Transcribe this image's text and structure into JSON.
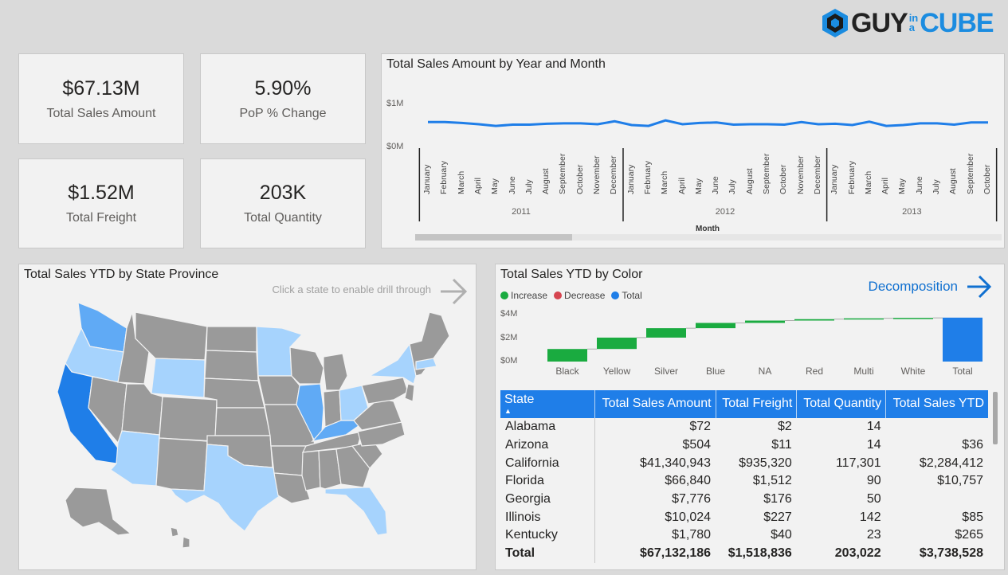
{
  "logo": {
    "guy": "GUY",
    "in": "in",
    "a": "a",
    "cube": "CUBE"
  },
  "kpis": [
    {
      "value": "$67.13M",
      "label": "Total Sales Amount"
    },
    {
      "value": "5.90%",
      "label": "PoP % Change"
    },
    {
      "value": "$1.52M",
      "label": "Total Freight"
    },
    {
      "value": "203K",
      "label": "Total Quantity"
    }
  ],
  "line_chart": {
    "title": "Total Sales Amount by Year and Month",
    "y_ticks": [
      "$1M",
      "$0M"
    ],
    "years": [
      "2011",
      "2012",
      "2013"
    ],
    "x_axis_title": "Month"
  },
  "map": {
    "title": "Total Sales YTD by State Province",
    "hint": "Click a state to enable drill through"
  },
  "waterfall": {
    "title": "Total Sales YTD by Color",
    "legend": [
      {
        "label": "Increase",
        "color": "#1aab40"
      },
      {
        "label": "Decrease",
        "color": "#d64550"
      },
      {
        "label": "Total",
        "color": "#1f7ee8"
      }
    ],
    "y_ticks": [
      "$4M",
      "$2M",
      "$0M"
    ],
    "link_label": "Decomposition"
  },
  "table": {
    "headers": [
      "State",
      "Total Sales Amount",
      "Total Freight",
      "Total Quantity",
      "Total Sales YTD"
    ],
    "rows": [
      [
        "Alabama",
        "$72",
        "$2",
        "14",
        ""
      ],
      [
        "Arizona",
        "$504",
        "$11",
        "14",
        "$36"
      ],
      [
        "California",
        "$41,340,943",
        "$935,320",
        "117,301",
        "$2,284,412"
      ],
      [
        "Florida",
        "$66,840",
        "$1,512",
        "90",
        "$10,757"
      ],
      [
        "Georgia",
        "$7,776",
        "$176",
        "50",
        ""
      ],
      [
        "Illinois",
        "$10,024",
        "$227",
        "142",
        "$85"
      ],
      [
        "Kentucky",
        "$1,780",
        "$40",
        "23",
        "$265"
      ]
    ],
    "total": [
      "Total",
      "$67,132,186",
      "$1,518,836",
      "203,022",
      "$3,738,528"
    ]
  },
  "chart_data": [
    {
      "type": "line",
      "title": "Total Sales Amount by Year and Month",
      "xlabel": "Month",
      "ylabel": "",
      "ylim": [
        0,
        1
      ],
      "x": [
        "January",
        "February",
        "March",
        "April",
        "May",
        "June",
        "July",
        "August",
        "September",
        "October",
        "November",
        "December",
        "January",
        "February",
        "March",
        "April",
        "May",
        "June",
        "July",
        "August",
        "September",
        "October",
        "November",
        "December",
        "January",
        "February",
        "March",
        "April",
        "May",
        "June",
        "July",
        "August",
        "September",
        "October"
      ],
      "x_groups": [
        {
          "name": "2011",
          "count": 12
        },
        {
          "name": "2012",
          "count": 12
        },
        {
          "name": "2013",
          "count": 10
        }
      ],
      "series": [
        {
          "values": [
            0.56,
            0.56,
            0.54,
            0.51,
            0.47,
            0.5,
            0.5,
            0.52,
            0.53,
            0.53,
            0.51,
            0.58,
            0.49,
            0.47,
            0.6,
            0.51,
            0.54,
            0.55,
            0.5,
            0.51,
            0.51,
            0.5,
            0.56,
            0.51,
            0.52,
            0.49,
            0.57,
            0.47,
            0.49,
            0.53,
            0.53,
            0.5,
            0.55,
            0.55
          ]
        }
      ]
    },
    {
      "type": "bar",
      "subtype": "waterfall",
      "title": "Total Sales YTD by Color",
      "categories": [
        "Black",
        "Yellow",
        "Silver",
        "Blue",
        "NA",
        "Red",
        "Multi",
        "White",
        "Total"
      ],
      "values": [
        1.07,
        0.97,
        0.8,
        0.45,
        0.2,
        0.12,
        0.07,
        0.04,
        3.74
      ],
      "kinds": [
        "increase",
        "increase",
        "increase",
        "increase",
        "increase",
        "increase",
        "increase",
        "increase",
        "total"
      ],
      "ylim": [
        0,
        4
      ],
      "unit": "$M"
    }
  ]
}
